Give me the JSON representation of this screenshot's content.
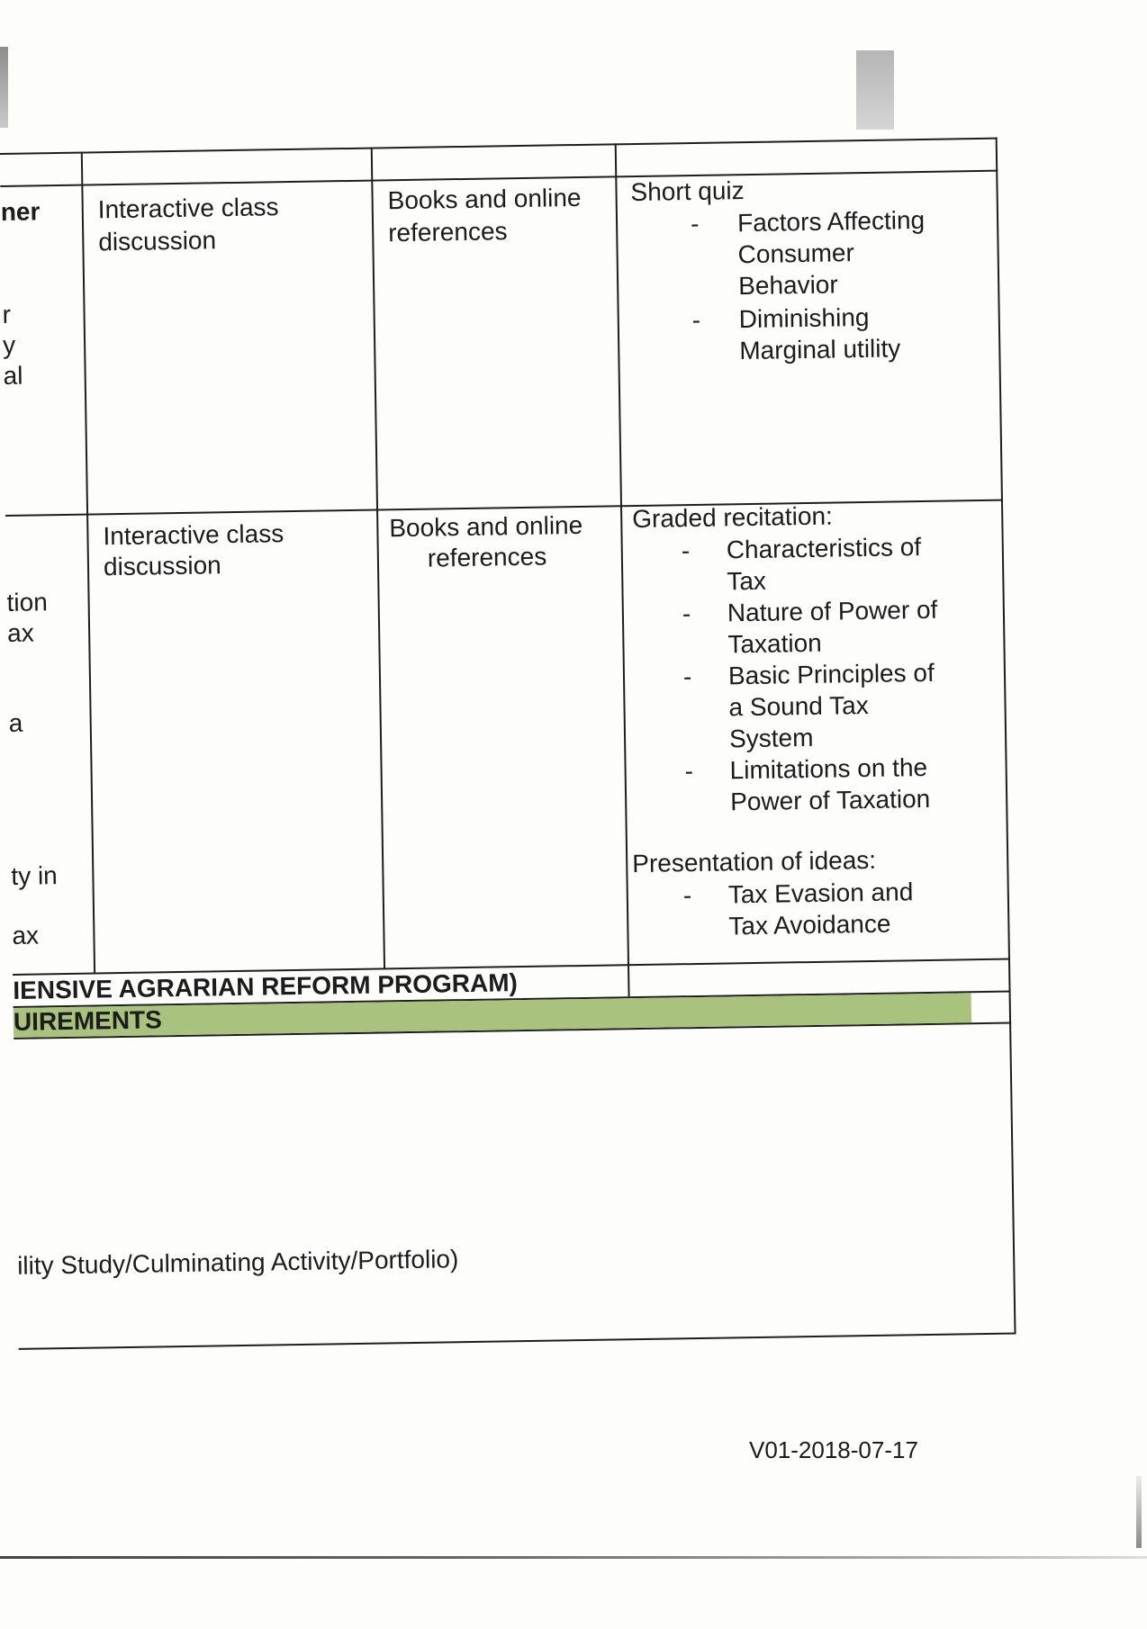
{
  "row1": {
    "left_fragments": [
      "ner",
      "r",
      "y",
      "al"
    ],
    "method": [
      "Interactive class",
      "discussion"
    ],
    "resources": [
      "Books and online",
      "references"
    ],
    "assessment_heading": "Short quiz",
    "assessment_items": [
      [
        "Factors Affecting",
        "Consumer",
        "Behavior"
      ],
      [
        "Diminishing",
        "Marginal utility"
      ]
    ]
  },
  "row2": {
    "left_fragments": [
      "tion",
      "ax",
      "a",
      "ty in",
      "ax"
    ],
    "method": [
      "Interactive class",
      "discussion"
    ],
    "resources": [
      "Books and online",
      "references"
    ],
    "assessment_heading": "Graded recitation:",
    "assessment_items": [
      [
        "Characteristics of",
        "Tax"
      ],
      [
        "Nature of Power of",
        "Taxation"
      ],
      [
        "Basic Principles of",
        "a Sound Tax",
        "System"
      ],
      [
        "Limitations on the",
        "Power of Taxation"
      ]
    ],
    "assessment_heading_2": "Presentation of ideas:",
    "assessment_items_2": [
      [
        "Tax Evasion and",
        "Tax Avoidance"
      ]
    ]
  },
  "bottom": {
    "program_row": "IENSIVE AGRARIAN REFORM PROGRAM)",
    "requirements_heading": "UIREMENTS",
    "requirements_text": "ility Study/Culminating Activity/Portfolio)"
  },
  "footer": {
    "version": "V01-2018-07-17"
  },
  "dash_glyph": "-"
}
